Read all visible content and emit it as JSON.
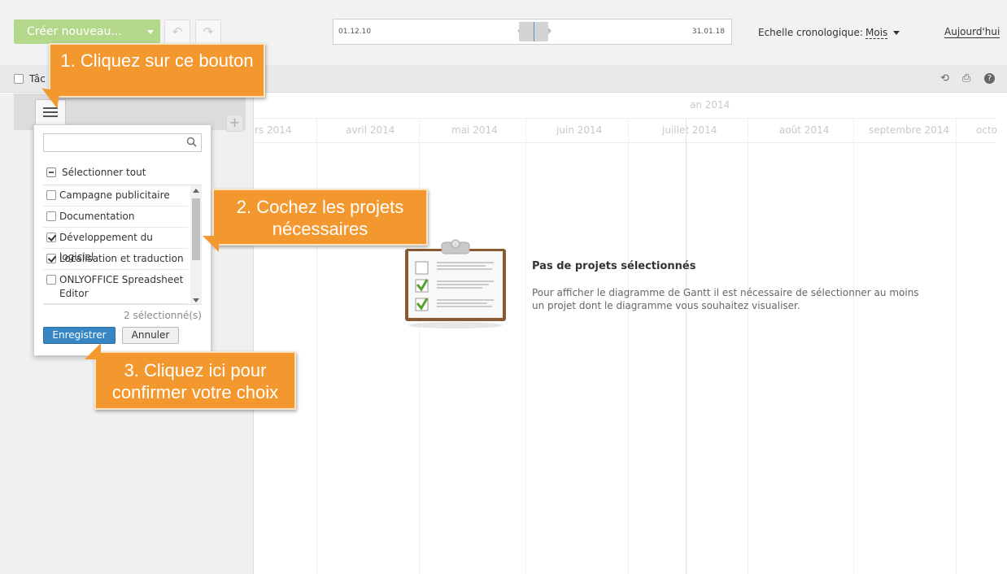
{
  "header": {
    "create_label": "Créer nouveau...",
    "timeline_start": "01.12.10",
    "timeline_end": "31.01.18",
    "scale_label": "Echelle cronologique:",
    "scale_value": "Mois",
    "today_label": "Aujourd'hui"
  },
  "toolbar": {
    "task_label": "Tâc"
  },
  "gantt": {
    "year": "an 2014",
    "months": [
      "rs 2014",
      "avril 2014",
      "mai 2014",
      "juin 2014",
      "juillet 2014",
      "août 2014",
      "septembre 2014",
      "octo"
    ],
    "empty_title": "Pas de projets sélectionnés",
    "empty_text": "Pour afficher le diagramme de Gantt il est nécessaire de sélectionner au moins un projet dont le diagramme vous souhaitez visualiser."
  },
  "dropdown": {
    "search_placeholder": "",
    "select_all_label": "Sélectionner tout",
    "items": [
      {
        "label": "Campagne publicitaire",
        "checked": false
      },
      {
        "label": "Documentation",
        "checked": false
      },
      {
        "label": "Développement du logiciel",
        "checked": true
      },
      {
        "label": "Localisation et traduction",
        "checked": true
      },
      {
        "label": "ONLYOFFICE Spreadsheet Editor",
        "checked": false
      }
    ],
    "selected_count": "2 sélectionné(s)",
    "save_label": "Enregistrer",
    "cancel_label": "Annuler"
  },
  "callouts": {
    "step1": "1. Cliquez sur ce bouton",
    "step2": "2. Cochez les projets nécessaires",
    "step3": "3. Cliquez ici pour confirmer votre choix"
  },
  "colors": {
    "accent_green": "#b4d88a",
    "primary_blue": "#3586c3",
    "callout_orange": "#f3982e"
  }
}
